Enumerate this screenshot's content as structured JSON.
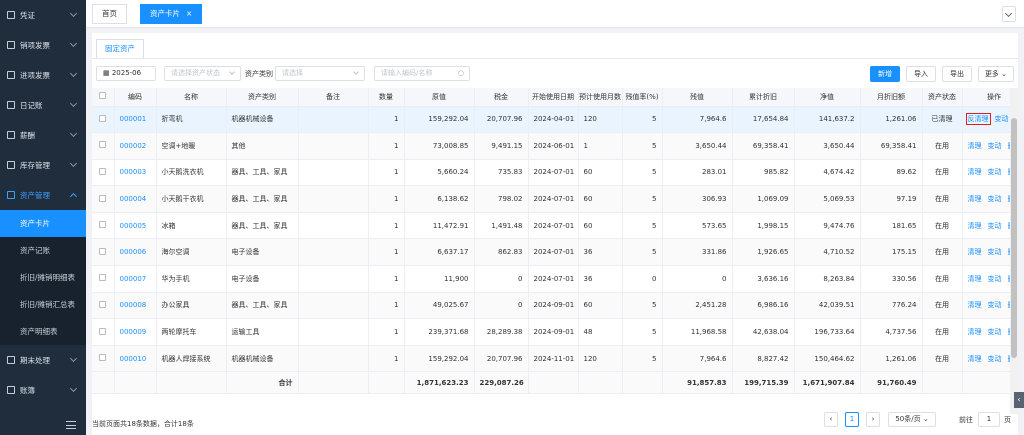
{
  "sidebar": {
    "items": [
      {
        "label": "凭证",
        "icon": "voucher-icon"
      },
      {
        "label": "销项发票",
        "icon": "invoice-out-icon"
      },
      {
        "label": "进项发票",
        "icon": "invoice-in-icon"
      },
      {
        "label": "日记账",
        "icon": "journal-icon"
      },
      {
        "label": "薪酬",
        "icon": "salary-icon"
      },
      {
        "label": "库存管理",
        "icon": "inventory-icon"
      },
      {
        "label": "资产管理",
        "icon": "asset-icon"
      },
      {
        "label": "期末处理",
        "icon": "period-end-icon"
      },
      {
        "label": "账簿",
        "icon": "ledger-icon"
      }
    ],
    "subitems": [
      "资产卡片",
      "资产记账",
      "折旧/摊销明细表",
      "折旧/摊销汇总表",
      "资产明细表"
    ]
  },
  "tabs": {
    "home": "首页",
    "current": "资产卡片",
    "close": "×"
  },
  "subtab": "固定资产",
  "filters": {
    "month": "2025-06",
    "status_placeholder": "请选择资产状态",
    "category_label": "资产类别",
    "category_placeholder": "请选择",
    "search_placeholder": "请输入编码/名称"
  },
  "buttons": {
    "add": "新增",
    "import": "导入",
    "export": "导出",
    "more": "更多"
  },
  "columns": [
    "编码",
    "名称",
    "资产类别",
    "备注",
    "数量",
    "原值",
    "税金",
    "开始使用日期",
    "预计使用月数",
    "残值率(%)",
    "残值",
    "累计折旧",
    "净值",
    "月折旧额",
    "资产状态",
    "操作"
  ],
  "rows": [
    {
      "code": "000001",
      "name": "折弯机",
      "cat": "机器机械设备",
      "note": "",
      "qty": "1",
      "orig": "159,292.04",
      "tax": "20,707.96",
      "date": "2024-04-01",
      "months": "120",
      "rate": "5",
      "resid": "7,964.6",
      "accum": "17,654.84",
      "net": "141,637.2",
      "monthly": "1,261.06",
      "status": "已清理",
      "a1": "反清理",
      "a2": "变动",
      "a3": "删除"
    },
    {
      "code": "000002",
      "name": "空调+地暖",
      "cat": "其他",
      "note": "",
      "qty": "1",
      "orig": "73,008.85",
      "tax": "9,491.15",
      "date": "2024-06-01",
      "months": "1",
      "rate": "5",
      "resid": "3,650.44",
      "accum": "69,358.41",
      "net": "3,650.44",
      "monthly": "69,358.41",
      "status": "在用",
      "a1": "清理",
      "a2": "变动",
      "a3": "删除"
    },
    {
      "code": "000003",
      "name": "小天鹅洗衣机",
      "cat": "器具、工具、家具",
      "note": "",
      "qty": "1",
      "orig": "5,660.24",
      "tax": "735.83",
      "date": "2024-07-01",
      "months": "60",
      "rate": "5",
      "resid": "283.01",
      "accum": "985.82",
      "net": "4,674.42",
      "monthly": "89.62",
      "status": "在用",
      "a1": "清理",
      "a2": "变动",
      "a3": "删除"
    },
    {
      "code": "000004",
      "name": "小天鹅干衣机",
      "cat": "器具、工具、家具",
      "note": "",
      "qty": "1",
      "orig": "6,138.62",
      "tax": "798.02",
      "date": "2024-07-01",
      "months": "60",
      "rate": "5",
      "resid": "306.93",
      "accum": "1,069.09",
      "net": "5,069.53",
      "monthly": "97.19",
      "status": "在用",
      "a1": "清理",
      "a2": "变动",
      "a3": "删除"
    },
    {
      "code": "000005",
      "name": "冰箱",
      "cat": "器具、工具、家具",
      "note": "",
      "qty": "1",
      "orig": "11,472.91",
      "tax": "1,491.48",
      "date": "2024-07-01",
      "months": "60",
      "rate": "5",
      "resid": "573.65",
      "accum": "1,998.15",
      "net": "9,474.76",
      "monthly": "181.65",
      "status": "在用",
      "a1": "清理",
      "a2": "变动",
      "a3": "删除"
    },
    {
      "code": "000006",
      "name": "海尔空调",
      "cat": "电子设备",
      "note": "",
      "qty": "1",
      "orig": "6,637.17",
      "tax": "862.83",
      "date": "2024-07-01",
      "months": "36",
      "rate": "5",
      "resid": "331.86",
      "accum": "1,926.65",
      "net": "4,710.52",
      "monthly": "175.15",
      "status": "在用",
      "a1": "清理",
      "a2": "变动",
      "a3": "删除"
    },
    {
      "code": "000007",
      "name": "华为手机",
      "cat": "电子设备",
      "note": "",
      "qty": "1",
      "orig": "11,900",
      "tax": "0",
      "date": "2024-07-01",
      "months": "36",
      "rate": "0",
      "resid": "0",
      "accum": "3,636.16",
      "net": "8,263.84",
      "monthly": "330.56",
      "status": "在用",
      "a1": "清理",
      "a2": "变动",
      "a3": "删除"
    },
    {
      "code": "000008",
      "name": "办公家具",
      "cat": "器具、工具、家具",
      "note": "",
      "qty": "1",
      "orig": "49,025.67",
      "tax": "0",
      "date": "2024-09-01",
      "months": "60",
      "rate": "5",
      "resid": "2,451.28",
      "accum": "6,986.16",
      "net": "42,039.51",
      "monthly": "776.24",
      "status": "在用",
      "a1": "清理",
      "a2": "变动",
      "a3": "删除"
    },
    {
      "code": "000009",
      "name": "两轮摩托车",
      "cat": "运输工具",
      "note": "",
      "qty": "1",
      "orig": "239,371.68",
      "tax": "28,289.38",
      "date": "2024-09-01",
      "months": "48",
      "rate": "5",
      "resid": "11,968.58",
      "accum": "42,638.04",
      "net": "196,733.64",
      "monthly": "4,737.56",
      "status": "在用",
      "a1": "清理",
      "a2": "变动",
      "a3": "删除"
    },
    {
      "code": "000010",
      "name": "机器人焊接系统",
      "cat": "机器机械设备",
      "note": "",
      "qty": "1",
      "orig": "159,292.04",
      "tax": "20,707.96",
      "date": "2024-11-01",
      "months": "120",
      "rate": "5",
      "resid": "7,964.6",
      "accum": "8,827.42",
      "net": "150,464.62",
      "monthly": "1,261.06",
      "status": "在用",
      "a1": "清理",
      "a2": "变动",
      "a3": "删除"
    }
  ],
  "totals": {
    "label": "合计",
    "orig": "1,871,623.23",
    "tax": "229,087.26",
    "resid": "91,857.83",
    "accum": "199,715.39",
    "net": "1,671,907.84",
    "monthly": "91,760.49"
  },
  "footer": {
    "summary": "当前页面共18条数据，合计18条",
    "page": "1",
    "page_size": "50条/页",
    "goto_label": "前往",
    "goto_value": "1",
    "page_unit": "页"
  }
}
